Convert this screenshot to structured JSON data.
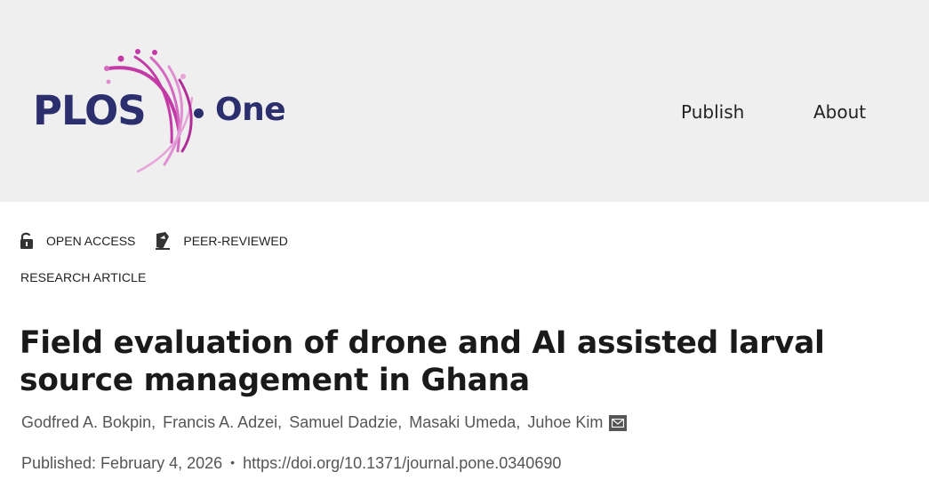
{
  "header": {
    "logo": {
      "text_primary": "PLOS",
      "text_secondary": "One",
      "brand_color": "#2b2f6e",
      "accent_color": "#c33aa6"
    },
    "nav": [
      {
        "label": "Publish"
      },
      {
        "label": "About"
      }
    ]
  },
  "badges": [
    {
      "label": "OPEN ACCESS",
      "icon": "unlocked-padlock-icon"
    },
    {
      "label": "PEER-REVIEWED",
      "icon": "peer-review-pen-icon"
    }
  ],
  "article": {
    "type": "RESEARCH ARTICLE",
    "title": "Field evaluation of drone and AI assisted larval source management in Ghana",
    "authors": [
      {
        "name": "Godfred A. Bokpin"
      },
      {
        "name": "Francis A. Adzei"
      },
      {
        "name": "Samuel Dadzie"
      },
      {
        "name": "Masaki Umeda"
      },
      {
        "name": "Juhoe Kim"
      }
    ],
    "author_separator": ",",
    "contact_icon": "mail-icon",
    "published": "Published: February 4, 2026",
    "bullet": "•",
    "doi": "https://doi.org/10.1371/journal.pone.0340690"
  }
}
